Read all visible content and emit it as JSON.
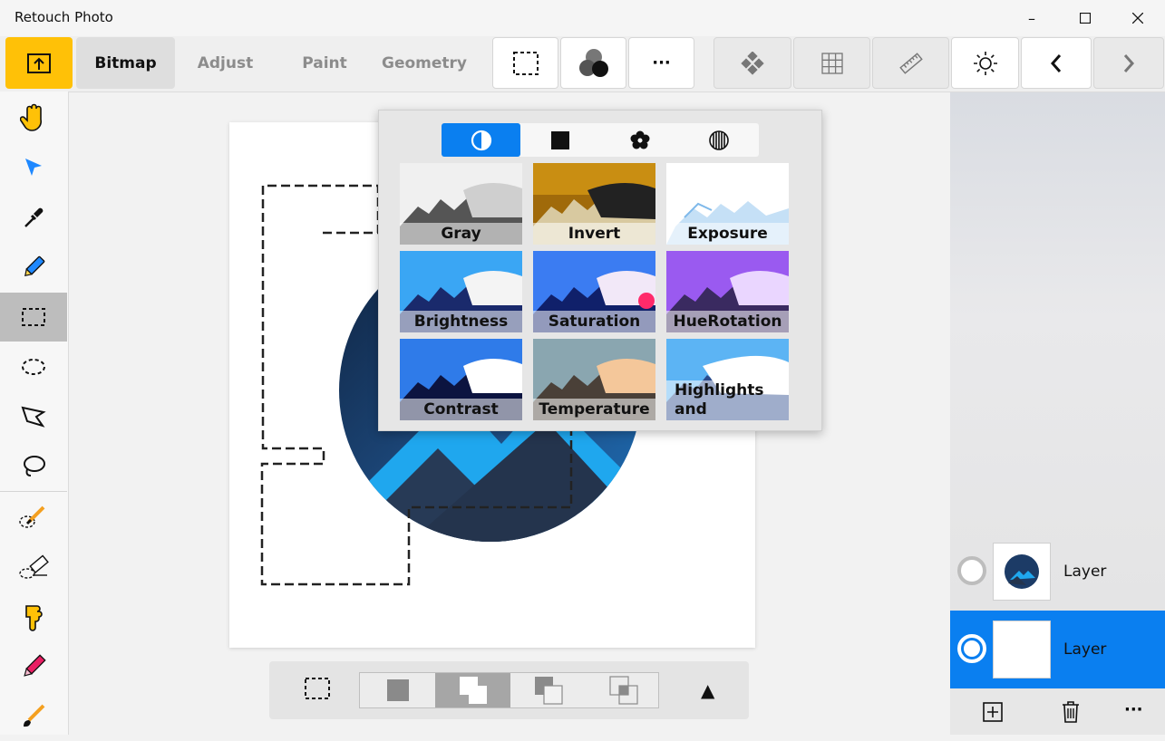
{
  "window": {
    "title": "Retouch Photo",
    "controls": {
      "minimize": "–",
      "maximize": "☐",
      "close": "✕"
    }
  },
  "toolbar": {
    "tabs": [
      "Bitmap",
      "Adjust",
      "Paint",
      "Geometry"
    ],
    "active_tab": "Bitmap",
    "more_label": "···"
  },
  "filters": {
    "categories": [
      "adjust-icon",
      "square-icon",
      "flower-icon",
      "stripes-icon"
    ],
    "items": [
      {
        "label": "Gray"
      },
      {
        "label": "Invert"
      },
      {
        "label": "Exposure"
      },
      {
        "label": "Brightness"
      },
      {
        "label": "Saturation"
      },
      {
        "label": "HueRotation"
      },
      {
        "label": "Contrast"
      },
      {
        "label": "Temperature"
      },
      {
        "label": "Highlights",
        "label2": "and Shadows"
      }
    ]
  },
  "layers": {
    "items": [
      {
        "name": "Layer",
        "selected": false
      },
      {
        "name": "Layer",
        "selected": true
      }
    ],
    "more_label": "···"
  },
  "bottombar": {
    "collapse_glyph": "▲"
  },
  "colors": {
    "accent": "#0a7ff0",
    "home_button": "#ffc107",
    "selected_layer": "#0a7ff0"
  }
}
